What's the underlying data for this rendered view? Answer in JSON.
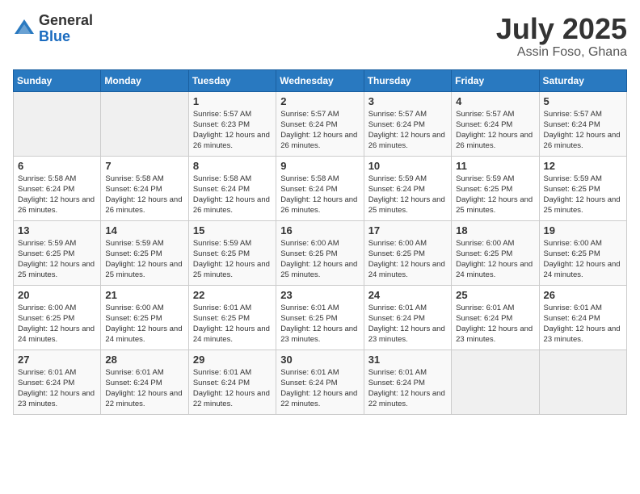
{
  "logo": {
    "general": "General",
    "blue": "Blue"
  },
  "title": "July 2025",
  "location": "Assin Foso, Ghana",
  "weekdays": [
    "Sunday",
    "Monday",
    "Tuesday",
    "Wednesday",
    "Thursday",
    "Friday",
    "Saturday"
  ],
  "weeks": [
    [
      {
        "day": "",
        "empty": true
      },
      {
        "day": "",
        "empty": true
      },
      {
        "day": "1",
        "sunrise": "Sunrise: 5:57 AM",
        "sunset": "Sunset: 6:23 PM",
        "daylight": "Daylight: 12 hours and 26 minutes."
      },
      {
        "day": "2",
        "sunrise": "Sunrise: 5:57 AM",
        "sunset": "Sunset: 6:24 PM",
        "daylight": "Daylight: 12 hours and 26 minutes."
      },
      {
        "day": "3",
        "sunrise": "Sunrise: 5:57 AM",
        "sunset": "Sunset: 6:24 PM",
        "daylight": "Daylight: 12 hours and 26 minutes."
      },
      {
        "day": "4",
        "sunrise": "Sunrise: 5:57 AM",
        "sunset": "Sunset: 6:24 PM",
        "daylight": "Daylight: 12 hours and 26 minutes."
      },
      {
        "day": "5",
        "sunrise": "Sunrise: 5:57 AM",
        "sunset": "Sunset: 6:24 PM",
        "daylight": "Daylight: 12 hours and 26 minutes."
      }
    ],
    [
      {
        "day": "6",
        "sunrise": "Sunrise: 5:58 AM",
        "sunset": "Sunset: 6:24 PM",
        "daylight": "Daylight: 12 hours and 26 minutes."
      },
      {
        "day": "7",
        "sunrise": "Sunrise: 5:58 AM",
        "sunset": "Sunset: 6:24 PM",
        "daylight": "Daylight: 12 hours and 26 minutes."
      },
      {
        "day": "8",
        "sunrise": "Sunrise: 5:58 AM",
        "sunset": "Sunset: 6:24 PM",
        "daylight": "Daylight: 12 hours and 26 minutes."
      },
      {
        "day": "9",
        "sunrise": "Sunrise: 5:58 AM",
        "sunset": "Sunset: 6:24 PM",
        "daylight": "Daylight: 12 hours and 26 minutes."
      },
      {
        "day": "10",
        "sunrise": "Sunrise: 5:59 AM",
        "sunset": "Sunset: 6:24 PM",
        "daylight": "Daylight: 12 hours and 25 minutes."
      },
      {
        "day": "11",
        "sunrise": "Sunrise: 5:59 AM",
        "sunset": "Sunset: 6:25 PM",
        "daylight": "Daylight: 12 hours and 25 minutes."
      },
      {
        "day": "12",
        "sunrise": "Sunrise: 5:59 AM",
        "sunset": "Sunset: 6:25 PM",
        "daylight": "Daylight: 12 hours and 25 minutes."
      }
    ],
    [
      {
        "day": "13",
        "sunrise": "Sunrise: 5:59 AM",
        "sunset": "Sunset: 6:25 PM",
        "daylight": "Daylight: 12 hours and 25 minutes."
      },
      {
        "day": "14",
        "sunrise": "Sunrise: 5:59 AM",
        "sunset": "Sunset: 6:25 PM",
        "daylight": "Daylight: 12 hours and 25 minutes."
      },
      {
        "day": "15",
        "sunrise": "Sunrise: 5:59 AM",
        "sunset": "Sunset: 6:25 PM",
        "daylight": "Daylight: 12 hours and 25 minutes."
      },
      {
        "day": "16",
        "sunrise": "Sunrise: 6:00 AM",
        "sunset": "Sunset: 6:25 PM",
        "daylight": "Daylight: 12 hours and 25 minutes."
      },
      {
        "day": "17",
        "sunrise": "Sunrise: 6:00 AM",
        "sunset": "Sunset: 6:25 PM",
        "daylight": "Daylight: 12 hours and 24 minutes."
      },
      {
        "day": "18",
        "sunrise": "Sunrise: 6:00 AM",
        "sunset": "Sunset: 6:25 PM",
        "daylight": "Daylight: 12 hours and 24 minutes."
      },
      {
        "day": "19",
        "sunrise": "Sunrise: 6:00 AM",
        "sunset": "Sunset: 6:25 PM",
        "daylight": "Daylight: 12 hours and 24 minutes."
      }
    ],
    [
      {
        "day": "20",
        "sunrise": "Sunrise: 6:00 AM",
        "sunset": "Sunset: 6:25 PM",
        "daylight": "Daylight: 12 hours and 24 minutes."
      },
      {
        "day": "21",
        "sunrise": "Sunrise: 6:00 AM",
        "sunset": "Sunset: 6:25 PM",
        "daylight": "Daylight: 12 hours and 24 minutes."
      },
      {
        "day": "22",
        "sunrise": "Sunrise: 6:01 AM",
        "sunset": "Sunset: 6:25 PM",
        "daylight": "Daylight: 12 hours and 24 minutes."
      },
      {
        "day": "23",
        "sunrise": "Sunrise: 6:01 AM",
        "sunset": "Sunset: 6:25 PM",
        "daylight": "Daylight: 12 hours and 23 minutes."
      },
      {
        "day": "24",
        "sunrise": "Sunrise: 6:01 AM",
        "sunset": "Sunset: 6:24 PM",
        "daylight": "Daylight: 12 hours and 23 minutes."
      },
      {
        "day": "25",
        "sunrise": "Sunrise: 6:01 AM",
        "sunset": "Sunset: 6:24 PM",
        "daylight": "Daylight: 12 hours and 23 minutes."
      },
      {
        "day": "26",
        "sunrise": "Sunrise: 6:01 AM",
        "sunset": "Sunset: 6:24 PM",
        "daylight": "Daylight: 12 hours and 23 minutes."
      }
    ],
    [
      {
        "day": "27",
        "sunrise": "Sunrise: 6:01 AM",
        "sunset": "Sunset: 6:24 PM",
        "daylight": "Daylight: 12 hours and 23 minutes."
      },
      {
        "day": "28",
        "sunrise": "Sunrise: 6:01 AM",
        "sunset": "Sunset: 6:24 PM",
        "daylight": "Daylight: 12 hours and 22 minutes."
      },
      {
        "day": "29",
        "sunrise": "Sunrise: 6:01 AM",
        "sunset": "Sunset: 6:24 PM",
        "daylight": "Daylight: 12 hours and 22 minutes."
      },
      {
        "day": "30",
        "sunrise": "Sunrise: 6:01 AM",
        "sunset": "Sunset: 6:24 PM",
        "daylight": "Daylight: 12 hours and 22 minutes."
      },
      {
        "day": "31",
        "sunrise": "Sunrise: 6:01 AM",
        "sunset": "Sunset: 6:24 PM",
        "daylight": "Daylight: 12 hours and 22 minutes."
      },
      {
        "day": "",
        "empty": true
      },
      {
        "day": "",
        "empty": true
      }
    ]
  ]
}
